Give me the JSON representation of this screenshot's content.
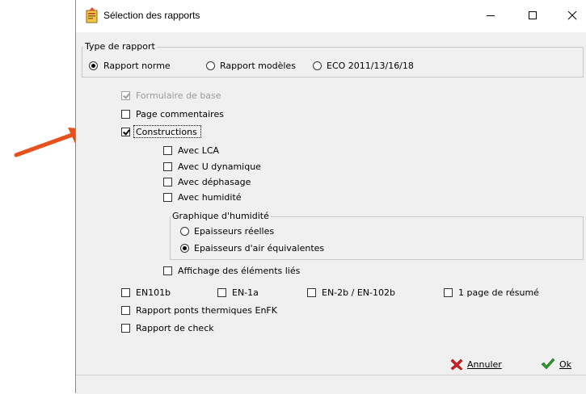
{
  "window": {
    "title": "Sélection des rapports",
    "buttons": {
      "minimize": "—",
      "maximize": "☐",
      "close": "✕"
    }
  },
  "report_type": {
    "group_label": "Type de rapport",
    "options": [
      {
        "label": "Rapport norme",
        "selected": true
      },
      {
        "label": "Rapport modèles",
        "selected": false
      },
      {
        "label": "ECO 2011/13/16/18",
        "selected": false
      }
    ]
  },
  "options": {
    "base_form": {
      "label": "Formulaire de base",
      "checked": true,
      "disabled": true
    },
    "comments_page": {
      "label": "Page commentaires",
      "checked": false
    },
    "constructions": {
      "label": "Constructions",
      "checked": true
    },
    "with_lca": {
      "label": "Avec LCA",
      "checked": false
    },
    "with_u_dynamic": {
      "label": "Avec U dynamique",
      "checked": false
    },
    "with_phase_shift": {
      "label": "Avec déphasage",
      "checked": false
    },
    "with_humidity": {
      "label": "Avec humidité",
      "checked": false
    },
    "show_linked_elements": {
      "label": "Affichage des éléments liés",
      "checked": false
    },
    "en101b": {
      "label": "EN101b",
      "checked": false
    },
    "en1a": {
      "label": "EN-1a",
      "checked": false
    },
    "en2b_en102b": {
      "label": "EN-2b / EN-102b",
      "checked": false
    },
    "summary_page": {
      "label": "1 page de résumé",
      "checked": false
    },
    "thermal_bridges": {
      "label": "Rapport ponts thermiques EnFK",
      "checked": false
    },
    "check_report": {
      "label": "Rapport de check",
      "checked": false
    }
  },
  "humidity_graph": {
    "group_label": "Graphique d'humidité",
    "options": [
      {
        "label": "Epaisseurs réelles",
        "selected": false
      },
      {
        "label": "Epaisseurs d'air équivalentes",
        "selected": true
      }
    ]
  },
  "actions": {
    "cancel_label": "Annuler",
    "ok_label": "Ok"
  },
  "colors": {
    "arrow": "#e8501e",
    "ok_check": "#2e9b2e",
    "cancel_x": "#d42020"
  }
}
